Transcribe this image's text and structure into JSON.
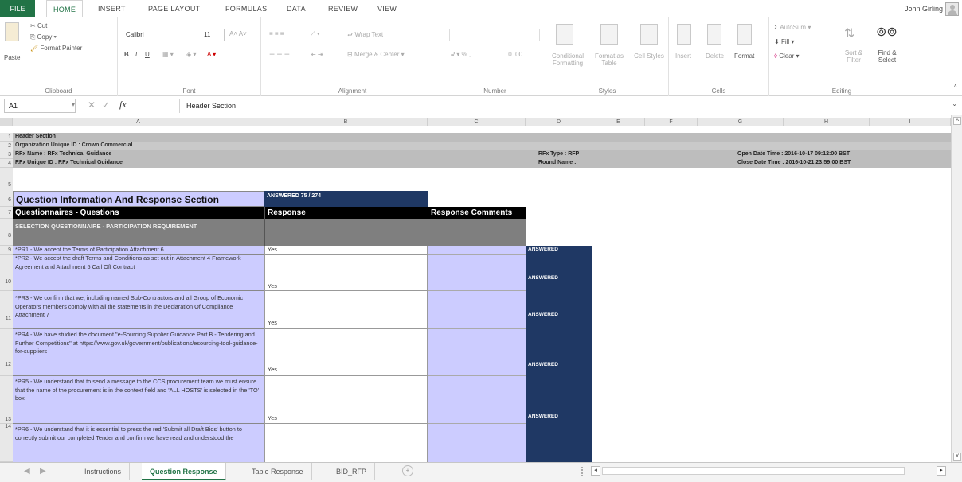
{
  "ribbon_tabs": {
    "file": "FILE",
    "home": "HOME",
    "insert": "INSERT",
    "page_layout": "PAGE LAYOUT",
    "formulas": "FORMULAS",
    "data": "DATA",
    "review": "REVIEW",
    "view": "VIEW"
  },
  "user_name": "John Girling",
  "clipboard": {
    "paste": "Paste",
    "cut": "Cut",
    "copy": "Copy",
    "format_painter": "Format Painter",
    "label": "Clipboard"
  },
  "font": {
    "name": "Calibri",
    "size": "11",
    "label": "Font"
  },
  "alignment": {
    "wrap_text": "Wrap Text",
    "merge_center": "Merge & Center",
    "label": "Alignment"
  },
  "number": {
    "label": "Number"
  },
  "styles": {
    "conditional": "Conditional Formatting",
    "format_as_table": "Format as Table",
    "cell_styles": "Cell Styles",
    "label": "Styles"
  },
  "cells": {
    "insert": "Insert",
    "delete": "Delete",
    "format": "Format",
    "label": "Cells"
  },
  "editing": {
    "autosum": "AutoSum",
    "fill": "Fill",
    "clear": "Clear",
    "sort_filter": "Sort & Filter",
    "find_select": "Find & Select",
    "label": "Editing"
  },
  "name_box": "A1",
  "fx": "fx",
  "formula_value": "Header Section",
  "columns": [
    "A",
    "B",
    "C",
    "D",
    "E",
    "F",
    "G",
    "H",
    "I"
  ],
  "rows": [
    "1",
    "2",
    "3",
    "4",
    "5",
    "6",
    "7",
    "8",
    "9",
    "10",
    "11",
    "12",
    "13",
    "14"
  ],
  "header": {
    "title": "Header Section",
    "org": "Organization Unique ID : Crown Commercial",
    "rfx_name": "RFx Name : RFx Technical Guidance",
    "rfx_unique": "RFx Unique ID : RFx Technical Guidance",
    "rfx_type": "RFx Type : RFP",
    "round_name": "Round Name :",
    "open_date": "Open Date Time : 2016-10-17 09:12:00 BST",
    "close_date": "Close Date Time : 2016-10-21 23:59:00 BST"
  },
  "section_title": "Question Information And Response Section",
  "answered_count": "ANSWERED 75 / 274",
  "col_questions": "Questionnaires - Questions",
  "col_response": "Response",
  "col_comments": "Response Comments",
  "group_title": "SELECTION QUESTIONNAIRE - PARTICIPATION REQUIREMENT",
  "questions": [
    {
      "text": "*PR1 - We accept the Terms of Participation Attachment 6",
      "response": "Yes",
      "status": "ANSWERED"
    },
    {
      "text": "*PR2 - We accept the draft Terms and Conditions as set out in Attachment 4 Framework Agreement and Attachment 5 Call Off Contract",
      "response": "Yes",
      "status": "ANSWERED"
    },
    {
      "text": "*PR3 - We confirm that we, including named Sub-Contractors and all Group of Economic Operators members comply with all the statements in the Declaration Of Compliance Attachment 7",
      "response": "Yes",
      "status": "ANSWERED"
    },
    {
      "text": "*PR4 - We have studied the document \"e-Sourcing Supplier Guidance Part B - Tendering and Further Competitions\" at https://www.gov.uk/government/publications/esourcing-tool-guidance-for-suppliers",
      "response": "Yes",
      "status": "ANSWERED"
    },
    {
      "text": "*PR5 - We understand that to send a message to the CCS procurement team we must ensure that the name of the procurement is in the context field and 'ALL HOSTS' is selected in the 'TO' box",
      "response": "Yes",
      "status": "ANSWERED"
    },
    {
      "text": "*PR6 - We understand that it is essential to press the red 'Submit all Draft Bids' button to correctly submit our completed Tender and confirm we have read and understood the",
      "response": "",
      "status": ""
    }
  ],
  "sheet_tabs": [
    "Instructions",
    "Question Response",
    "Table Response",
    "BID_RFP"
  ],
  "colors": {
    "excel_green": "#217346",
    "navy": "#1f3864",
    "lavender": "#ccccff",
    "gray_header": "#bdbdbd"
  }
}
